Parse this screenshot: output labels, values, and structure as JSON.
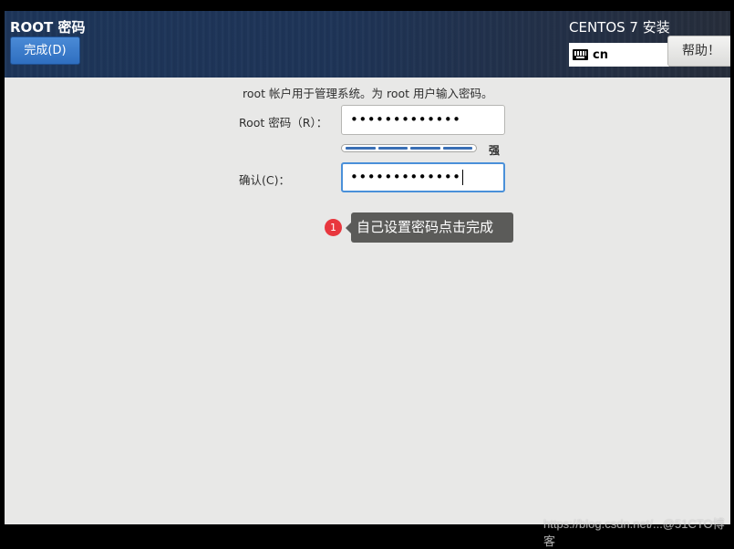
{
  "header": {
    "spoke_title": "ROOT 密码",
    "done_button": "完成(D)",
    "product_title": "CENTOS 7 安装",
    "keyboard_layout": "cn",
    "keyboard_icon": "keyboard-icon",
    "help_button": "帮助！"
  },
  "form": {
    "intro": "root 帐户用于管理系统。为 root 用户输入密码。",
    "password_label": "Root 密码（R）：",
    "password_value": "•••••••••••••",
    "password_length": 13,
    "strength": {
      "segments_total": 4,
      "segments_filled": 4,
      "label": "强",
      "color": "#3a6fb5"
    },
    "confirm_label": "确认(C)：",
    "confirm_value": "•••••••••••••",
    "confirm_focused": true
  },
  "annotation": {
    "step_number": "1",
    "text": "自己设置密码点击完成",
    "badge_color": "#e8373e"
  },
  "watermark": "https://blog.csdn.net/...@51CTO博客"
}
